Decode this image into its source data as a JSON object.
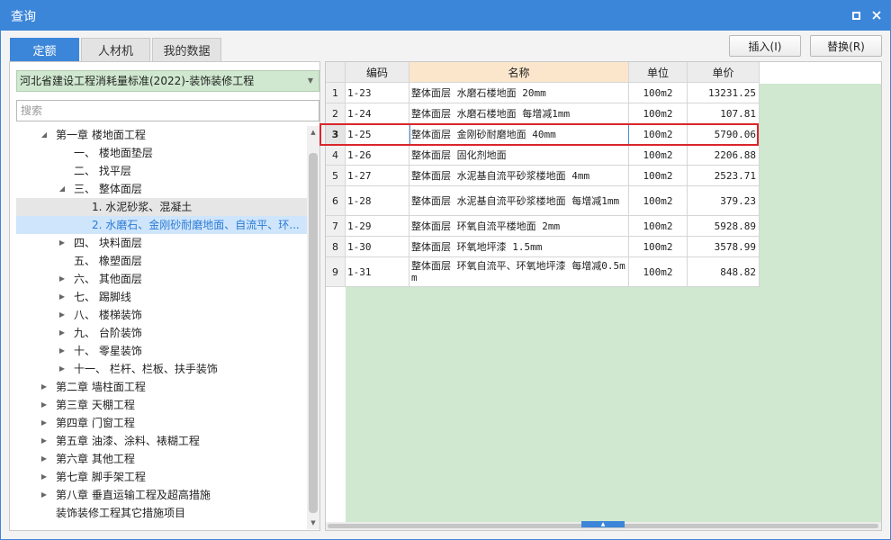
{
  "window": {
    "title": "查询"
  },
  "tabs": [
    {
      "label": "定额",
      "active": true
    },
    {
      "label": "人材机",
      "active": false
    },
    {
      "label": "我的数据",
      "active": false
    }
  ],
  "actions": {
    "insert_label": "插入(I)",
    "replace_label": "替换(R)"
  },
  "left": {
    "standard_select": "河北省建设工程消耗量标准(2022)-装饰装修工程",
    "search_placeholder": "搜索",
    "tree": [
      {
        "label": "第一章 楼地面工程",
        "level": 1,
        "arrow": "down"
      },
      {
        "label": "一、 楼地面垫层",
        "level": 2,
        "arrow": "none"
      },
      {
        "label": "二、 找平层",
        "level": 2,
        "arrow": "none"
      },
      {
        "label": "三、 整体面层",
        "level": 2,
        "arrow": "down"
      },
      {
        "label": "1. 水泥砂浆、混凝土",
        "level": 3,
        "arrow": "none",
        "highlight": "gray"
      },
      {
        "label": "2. 水磨石、金刚砂耐磨地面、自流平、环...",
        "level": 3,
        "arrow": "none",
        "highlight": "blue"
      },
      {
        "label": "四、 块料面层",
        "level": 2,
        "arrow": "right"
      },
      {
        "label": "五、 橡塑面层",
        "level": 2,
        "arrow": "none"
      },
      {
        "label": "六、 其他面层",
        "level": 2,
        "arrow": "right"
      },
      {
        "label": "七、 踢脚线",
        "level": 2,
        "arrow": "right"
      },
      {
        "label": "八、 楼梯装饰",
        "level": 2,
        "arrow": "right"
      },
      {
        "label": "九、 台阶装饰",
        "level": 2,
        "arrow": "right"
      },
      {
        "label": "十、 零星装饰",
        "level": 2,
        "arrow": "right"
      },
      {
        "label": "十一、 栏杆、栏板、扶手装饰",
        "level": 2,
        "arrow": "right"
      },
      {
        "label": "第二章 墙柱面工程",
        "level": 1,
        "arrow": "right"
      },
      {
        "label": "第三章 天棚工程",
        "level": 1,
        "arrow": "right"
      },
      {
        "label": "第四章 门窗工程",
        "level": 1,
        "arrow": "right"
      },
      {
        "label": "第五章 油漆、涂料、裱糊工程",
        "level": 1,
        "arrow": "right"
      },
      {
        "label": "第六章 其他工程",
        "level": 1,
        "arrow": "right"
      },
      {
        "label": "第七章 脚手架工程",
        "level": 1,
        "arrow": "right"
      },
      {
        "label": "第八章 垂直运输工程及超高措施",
        "level": 1,
        "arrow": "right"
      },
      {
        "label": "装饰装修工程其它措施项目",
        "level": 1,
        "arrow": "none"
      }
    ]
  },
  "table": {
    "columns": [
      "编码",
      "名称",
      "单位",
      "单价"
    ],
    "rows": [
      {
        "num": "1",
        "code": "1-23",
        "name": "整体面层 水磨石楼地面 20mm",
        "unit": "100m2",
        "price": "13231.25"
      },
      {
        "num": "2",
        "code": "1-24",
        "name": "整体面层 水磨石楼地面 每增减1mm",
        "unit": "100m2",
        "price": "107.81"
      },
      {
        "num": "3",
        "code": "1-25",
        "name": "整体面层 金刚砂耐磨地面 40mm",
        "unit": "100m2",
        "price": "5790.06",
        "selected": true
      },
      {
        "num": "4",
        "code": "1-26",
        "name": "整体面层 固化剂地面",
        "unit": "100m2",
        "price": "2206.88"
      },
      {
        "num": "5",
        "code": "1-27",
        "name": "整体面层 水泥基自流平砂浆楼地面 4mm",
        "unit": "100m2",
        "price": "2523.71"
      },
      {
        "num": "6",
        "code": "1-28",
        "name": "整体面层 水泥基自流平砂浆楼地面 每增减1mm",
        "unit": "100m2",
        "price": "379.23"
      },
      {
        "num": "7",
        "code": "1-29",
        "name": "整体面层 环氧自流平楼地面 2mm",
        "unit": "100m2",
        "price": "5928.89"
      },
      {
        "num": "8",
        "code": "1-30",
        "name": "整体面层 环氧地坪漆 1.5mm",
        "unit": "100m2",
        "price": "3578.99"
      },
      {
        "num": "9",
        "code": "1-31",
        "name": "整体面层 环氧自流平、环氧地坪漆 每增减0.5mm",
        "unit": "100m2",
        "price": "848.82"
      }
    ]
  },
  "colors": {
    "accent": "#3c86d9",
    "selection_border": "#d9262b",
    "name_header": "#fbe6cc",
    "filler_green": "#cfe8cf"
  }
}
